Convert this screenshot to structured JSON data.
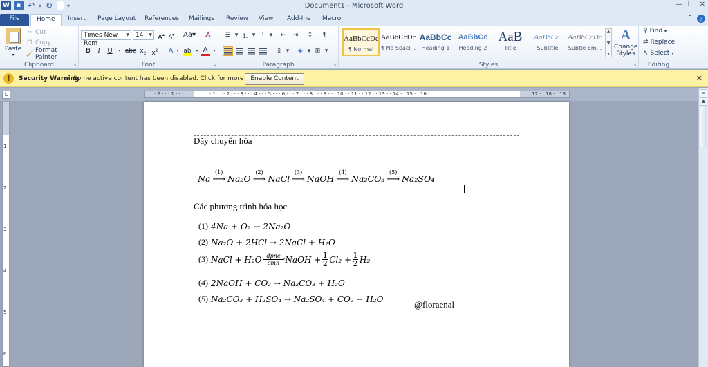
{
  "window": {
    "title": "Document1 - Microsoft Word"
  },
  "tabs": [
    "File",
    "Home",
    "Insert",
    "Page Layout",
    "References",
    "Mailings",
    "Review",
    "View",
    "Add-Ins",
    "Macro"
  ],
  "clipboard": {
    "paste": "Paste",
    "cut": "Cut",
    "copy": "Copy",
    "format_painter": "Format Painter",
    "label": "Clipboard"
  },
  "font": {
    "name": "Times New Rom",
    "size": "14",
    "label": "Font"
  },
  "paragraph": {
    "label": "Paragraph"
  },
  "styles": {
    "items": [
      {
        "sample": "AaBbCcDc",
        "name": "¶ Normal"
      },
      {
        "sample": "AaBbCcDc",
        "name": "¶ No Spaci..."
      },
      {
        "sample": "AaBbCc",
        "name": "Heading 1"
      },
      {
        "sample": "AaBbCc",
        "name": "Heading 2"
      },
      {
        "sample": "AaB",
        "name": "Title"
      },
      {
        "sample": "AaBbCc.",
        "name": "Subtitle"
      },
      {
        "sample": "AaBbCcDc",
        "name": "Subtle Em..."
      }
    ],
    "change_styles": "Change Styles",
    "label": "Styles"
  },
  "editing": {
    "find": "Find",
    "replace": "Replace",
    "select": "Select",
    "label": "Editing"
  },
  "security": {
    "title": "Security Warning",
    "message": "Some active content has been disabled. Click for more details.",
    "button": "Enable Content"
  },
  "document": {
    "heading1": "Dãy chuyển hóa",
    "chain": {
      "species": [
        "Na",
        "Na₂O",
        "NaCl",
        "NaOH",
        "Na₂CO₃",
        "Na₂SO₄"
      ],
      "steps": [
        "(1)",
        "(2)",
        "(3)",
        "(4)",
        "(5)"
      ]
    },
    "heading2": "Các phương trình hóa học",
    "equations": {
      "e1": {
        "num": "(1)",
        "text": "4Na + O₂ → 2Na₂O"
      },
      "e2": {
        "num": "(2)",
        "text": "Na₂O + 2HCl → 2NaCl + H₂O"
      },
      "e3": {
        "num": "(3)",
        "lhs": "NaCl + H₂O",
        "cond_top": "dpnc",
        "cond_bottom": "cmn",
        "mid": "NaOH +",
        "frac_num": "1",
        "frac_den": "2",
        "cl": "Cl₂ +",
        "h": "H₂"
      },
      "e4": {
        "num": "(4)",
        "text": "2NaOH + CO₂ → Na₂CO₃ + H₂O"
      },
      "e5": {
        "num": "(5)",
        "text": "Na₂CO₃ + H₂SO₄ → Na₂SO₄ + CO₂ + H₂O"
      }
    },
    "watermark": "@floraenal"
  }
}
